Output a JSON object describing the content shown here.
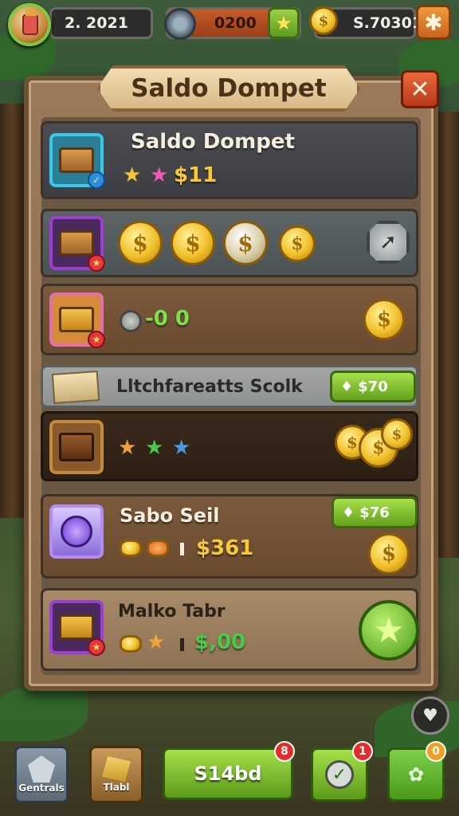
{
  "topbar": {
    "level_value": "2. 2021",
    "energy_value": "0200",
    "coin_value": "S.70301",
    "coin_symbol": "$"
  },
  "panel": {
    "title": "Saldo Dompet",
    "close_symbol": "✕"
  },
  "rows": {
    "wallet": {
      "title": "Saldo Dompet",
      "amount": "$11"
    },
    "coins_row": {
      "coin_symbol": "$"
    },
    "treasure_row": {
      "value": "-0 0"
    },
    "market": {
      "title": "Lltchfareatts Scolk",
      "price": "$70"
    },
    "chest_row": {},
    "sabo": {
      "title": "Sabo Seil",
      "price": "$76",
      "amount": "$361"
    },
    "malko": {
      "title": "Malko Tabr",
      "amount": "$,00"
    }
  },
  "bottom_nav": {
    "item1_label": "Gentrals",
    "item2_label": "Tlabl",
    "main_button_label": "S14bd",
    "main_badge": "8",
    "check_badge": "1",
    "shop_badge": "0"
  },
  "colors": {
    "accent_green": "#7ec93f",
    "gold": "#f1c02a",
    "close_red": "#e96a3a"
  },
  "icons": [
    "avatar",
    "disk-icon",
    "star-icon",
    "coin-icon",
    "close-icon",
    "chest-icon",
    "gem-icon",
    "arrow-icon",
    "heart-icon",
    "check-icon"
  ]
}
